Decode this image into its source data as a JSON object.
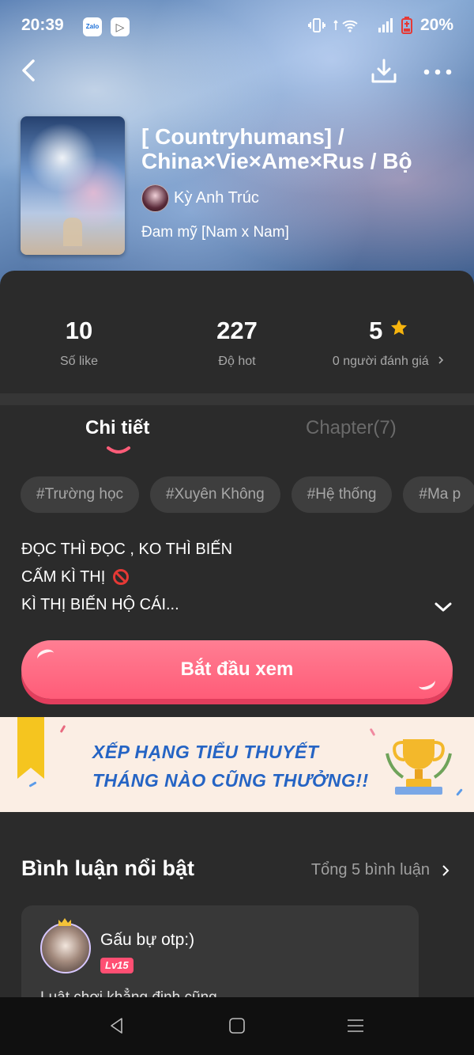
{
  "status_bar": {
    "time": "20:39",
    "badges": [
      "Zalo",
      "▷"
    ],
    "battery": "20%"
  },
  "book": {
    "title": "[ Countryhumans] / China×Vie×Ame×Rus / Bộ",
    "author": "Kỳ Anh Trúc",
    "genre": "Đam mỹ [Nam x Nam]"
  },
  "stats": {
    "likes": {
      "value": "10",
      "label": "Số like"
    },
    "hot": {
      "value": "227",
      "label": "Độ hot"
    },
    "rating": {
      "value": "5",
      "label": "0 người đánh giá"
    }
  },
  "tabs": [
    {
      "label": "Chi tiết",
      "active": true
    },
    {
      "label": "Chapter(7)",
      "active": false
    }
  ],
  "tags": [
    "#Trường học",
    "#Xuyên Không",
    "#Hệ thống",
    "#Ma p"
  ],
  "description": [
    "ĐỌC THÌ ĐỌC , KO THÌ BIẾN",
    "CẤM KÌ THỊ",
    "KÌ THỊ BIẾN HỘ CÁI..."
  ],
  "start_button": "Bắt đầu xem",
  "banner": {
    "line1": "XẾP HẠNG TIỂU THUYẾT",
    "line2": "THÁNG NÀO CŨNG THƯỞNG!!"
  },
  "comments": {
    "title": "Bình luận nổi bật",
    "total": "Tổng 5 bình luận",
    "items": [
      {
        "name": "Gấu bự otp:)",
        "level": "Lv15",
        "text": "Luật chơi khẳng định cũng..."
      }
    ]
  },
  "colors": {
    "accent": "#ff5c78",
    "banner_text": "#2564c4",
    "star": "#f6b40e",
    "background": "#2b2b2b"
  },
  "icons": [
    "back-icon",
    "download-icon",
    "more-icon",
    "star-icon",
    "chevron-right-icon",
    "chevron-down-icon",
    "no-icon",
    "trophy-icon",
    "nav-back-icon",
    "nav-home-icon",
    "nav-menu-icon"
  ]
}
